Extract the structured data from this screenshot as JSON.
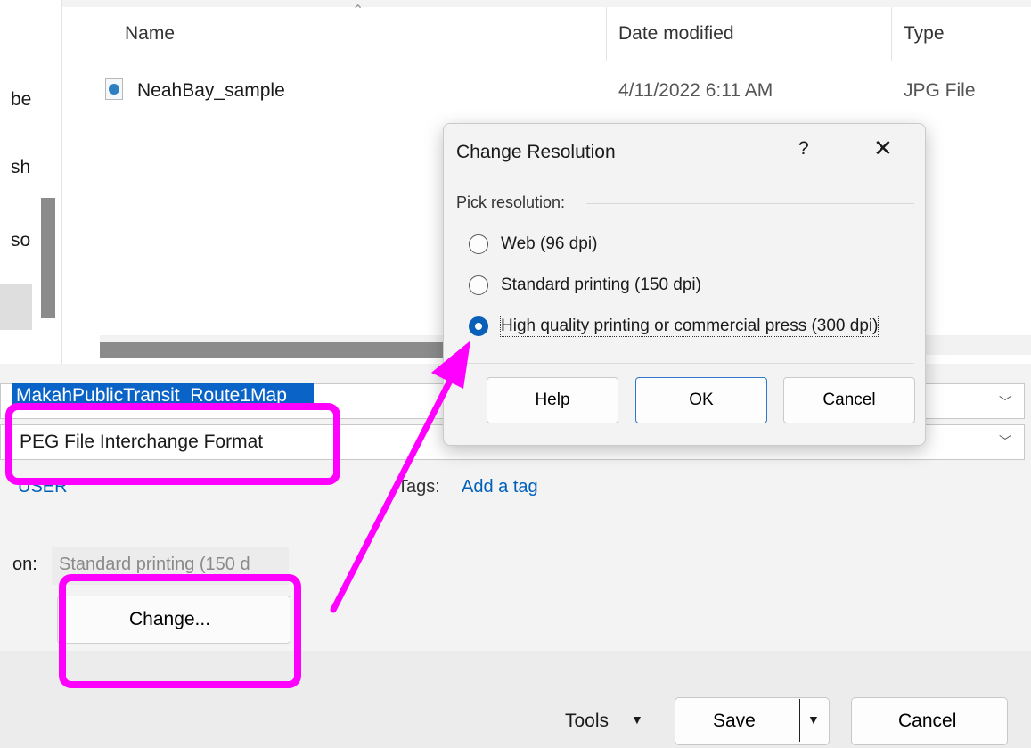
{
  "nav_pane": {
    "items": [
      "be",
      "sh",
      "so"
    ]
  },
  "file_list": {
    "columns": [
      "Name",
      "Date modified",
      "Type"
    ],
    "rows": [
      {
        "name": "NeahBay_sample",
        "date": "4/11/2022 6:11 AM",
        "type": "JPG File"
      }
    ]
  },
  "save_fields": {
    "file_name": "MakahPublicTransit_Route1Map",
    "save_as_type": "PEG File Interchange Format",
    "author": "USER",
    "tags_label": "Tags:",
    "tags_link": "Add a tag",
    "resolution_label": "on:",
    "resolution_value": "Standard printing (150 d",
    "change_label": "Change..."
  },
  "footer": {
    "tools_label": "Tools",
    "save_label": "Save",
    "cancel_label": "Cancel"
  },
  "dialog": {
    "title": "Change Resolution",
    "help_glyph": "?",
    "close_glyph": "✕",
    "group_label": "Pick resolution:",
    "options": [
      {
        "label": "Web (96 dpi)",
        "checked": false
      },
      {
        "label": "Standard printing (150 dpi)",
        "checked": false
      },
      {
        "label": "High quality printing or commercial press (300 dpi)",
        "checked": true
      }
    ],
    "buttons": {
      "help": "Help",
      "ok": "OK",
      "cancel": "Cancel"
    }
  },
  "colors": {
    "annotation": "#ff00ff",
    "selection": "#0a64c8",
    "link": "#0060b8"
  },
  "icons": {
    "file_icon": "image-file-icon",
    "dropdown": "chevron-down-icon",
    "sort": "sort-up-icon"
  }
}
